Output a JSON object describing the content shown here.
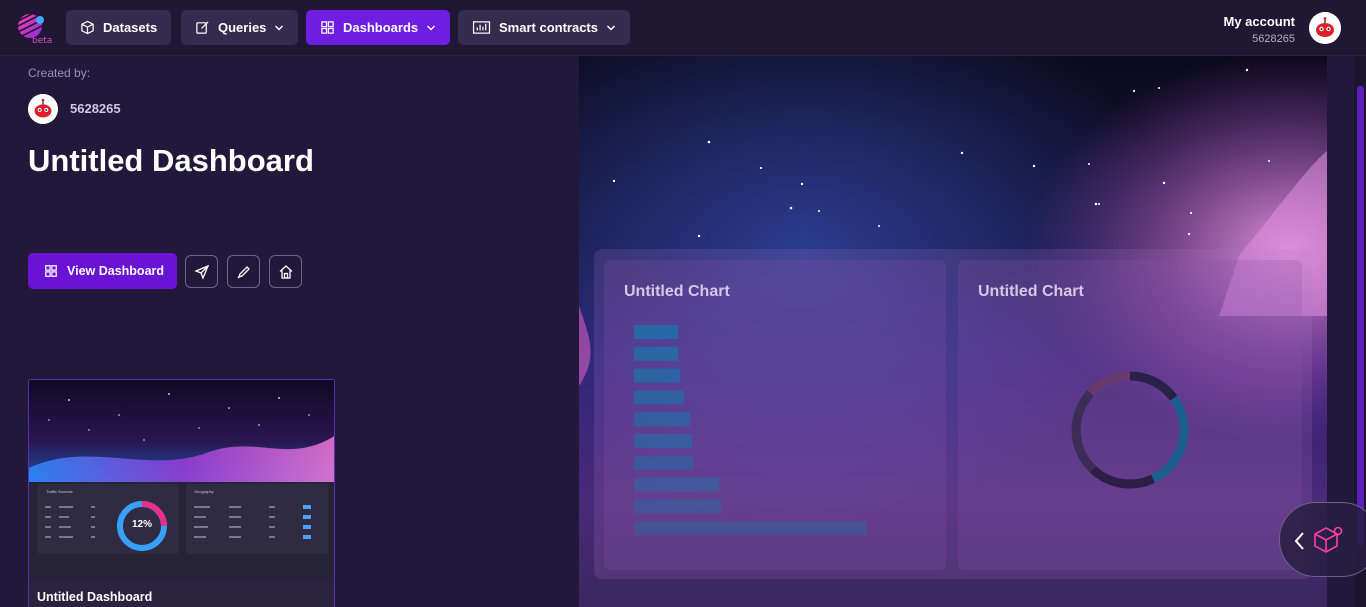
{
  "nav": {
    "logo_badge": "beta",
    "datasets": "Datasets",
    "queries": "Queries",
    "dashboards": "Dashboards",
    "smart_contracts": "Smart contracts",
    "account_label": "My account",
    "account_id": "5628265"
  },
  "dashboard": {
    "created_by_label": "Created by:",
    "creator_id": "5628265",
    "title": "Untitled Dashboard",
    "view_button": "View Dashboard"
  },
  "thumbnail": {
    "title": "Untitled Dashboard",
    "traffic_title": "Traffic Sources",
    "geo_title": "Geography",
    "donut_value": "12%"
  },
  "preview": {
    "charts": [
      {
        "title": "Untitled Chart",
        "type": "bar"
      },
      {
        "title": "Untitled Chart",
        "type": "donut"
      }
    ]
  },
  "chart_data": [
    {
      "type": "bar",
      "title": "Untitled Chart",
      "orientation": "horizontal",
      "values": [
        44,
        44,
        46,
        50,
        56,
        58,
        59,
        85,
        87,
        233
      ]
    },
    {
      "type": "pie",
      "title": "Untitled Chart",
      "values": [
        15,
        28,
        19,
        25,
        13
      ]
    }
  ],
  "colors": {
    "accent": "#6d1ee0",
    "bar": "#1f6fa8"
  }
}
